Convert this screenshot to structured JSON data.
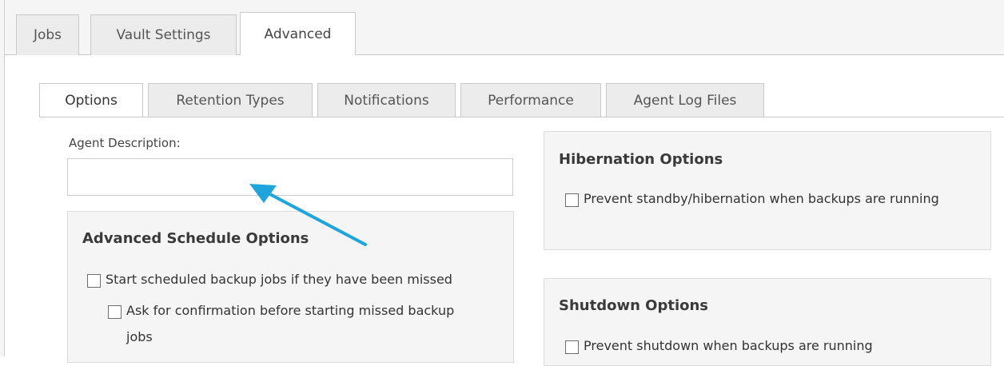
{
  "main_tabs": [
    {
      "label": "Jobs",
      "active": false
    },
    {
      "label": "Vault Settings",
      "active": false
    },
    {
      "label": "Advanced",
      "active": true
    }
  ],
  "sub_tabs": [
    {
      "label": "Options",
      "active": true
    },
    {
      "label": "Retention Types",
      "active": false
    },
    {
      "label": "Notifications",
      "active": false
    },
    {
      "label": "Performance",
      "active": false
    },
    {
      "label": "Agent Log Files",
      "active": false
    }
  ],
  "agent_description": {
    "label": "Agent Description:",
    "value": ""
  },
  "advanced_schedule": {
    "title": "Advanced Schedule Options",
    "start_missed": {
      "label": "Start scheduled backup jobs if they have been missed",
      "checked": false
    },
    "ask_confirmation": {
      "label": "Ask for confirmation before starting missed backup jobs",
      "checked": false
    }
  },
  "hibernation": {
    "title": "Hibernation Options",
    "prevent_standby": {
      "label": "Prevent standby/hibernation when backups are running",
      "checked": false
    }
  },
  "shutdown": {
    "title": "Shutdown Options",
    "prevent_shutdown": {
      "label": "Prevent shutdown when backups are running",
      "checked": false
    }
  },
  "annotation": {
    "arrow_color": "#1ea6dc"
  },
  "colors": {
    "panel_bg": "#f5f5f5",
    "tab_inactive_bg": "#ececec",
    "border": "#c9c9c9"
  }
}
